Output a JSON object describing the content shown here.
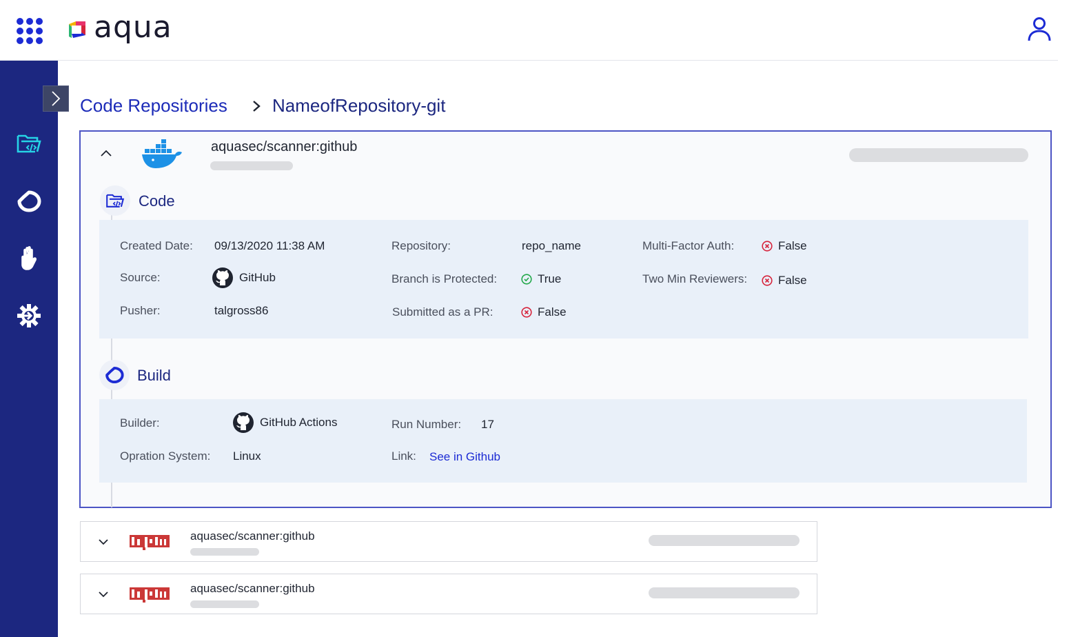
{
  "app": {
    "logo_text": "aqua",
    "brand_color": "#1c2bd4",
    "sidebar_color": "#1c2780"
  },
  "breadcrumb": {
    "parent": "Code Repositories",
    "current": "NameofRepository-git"
  },
  "sidebar": {
    "items": [
      {
        "icon": "code-folder-icon",
        "active": true
      },
      {
        "icon": "pipeline-loop-icon",
        "active": false
      },
      {
        "icon": "hand-stop-icon",
        "active": false
      },
      {
        "icon": "gear-arrow-icon",
        "active": false
      }
    ]
  },
  "main_card": {
    "title": "aquasec/scanner:github",
    "icon": "docker-icon",
    "code_section": {
      "title": "Code",
      "created_date_label": "Created Date:",
      "created_date_value": "09/13/2020 11:38 AM",
      "source_label": "Source:",
      "source_value": "GitHub",
      "pusher_label": "Pusher:",
      "pusher_value": "talgross86",
      "repository_label": "Repository:",
      "repository_value": "repo_name",
      "branch_protected_label": "Branch is Protected:",
      "branch_protected_value": "True",
      "submitted_pr_label": "Submitted as a PR:",
      "submitted_pr_value": "False",
      "mfa_label": "Multi-Factor Auth:",
      "mfa_value": "False",
      "two_min_reviewers_label": "Two Min Reviewers:",
      "two_min_reviewers_value": "False"
    },
    "build_section": {
      "title": "Build",
      "builder_label": "Builder:",
      "builder_value": "GitHub Actions",
      "os_label": "Opration System:",
      "os_value": "Linux",
      "run_number_label": "Run Number:",
      "run_number_value": "17",
      "link_label": "Link:",
      "link_value": "See in Github"
    }
  },
  "collapsed_cards": [
    {
      "title": "aquasec/scanner:github",
      "icon": "npm-icon"
    },
    {
      "title": "aquasec/scanner:github",
      "icon": "npm-icon"
    }
  ],
  "status_colors": {
    "true": "#22a84a",
    "false": "#d6243c",
    "link": "#1c2bd4"
  }
}
